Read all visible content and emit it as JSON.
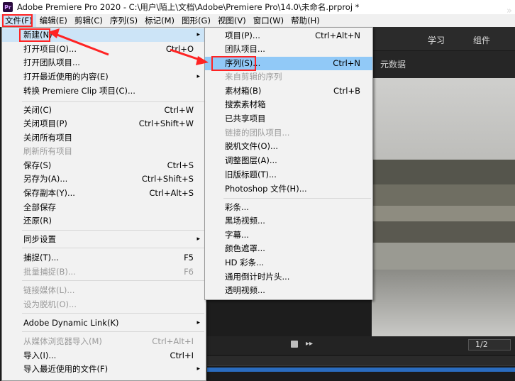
{
  "window": {
    "title": "Adobe Premiere Pro 2020 - C:\\用户\\陌上\\文档\\Adobe\\Premiere Pro\\14.0\\未命名.prproj *",
    "logo_text": "Pr"
  },
  "menubar": [
    "文件(F)",
    "编辑(E)",
    "剪辑(C)",
    "序列(S)",
    "标记(M)",
    "图形(G)",
    "视图(V)",
    "窗口(W)",
    "帮助(H)"
  ],
  "workspace": {
    "tabs": [
      "学习",
      "组件"
    ],
    "more": "»"
  },
  "panel": {
    "tab_label": "元数据"
  },
  "transport": {
    "zoom": "1/2"
  },
  "file_menu": {
    "items": [
      {
        "label": "新建(N)",
        "shortcut": "",
        "submenu": true,
        "state": "highlight"
      },
      {
        "label": "打开项目(O)...",
        "shortcut": "Ctrl+O",
        "state": "normal"
      },
      {
        "label": "打开团队项目...",
        "shortcut": "",
        "state": "normal"
      },
      {
        "label": "打开最近使用的内容(E)",
        "shortcut": "",
        "submenu": true,
        "state": "normal"
      },
      {
        "label": "转换 Premiere Clip 项目(C)...",
        "shortcut": "",
        "state": "normal"
      },
      {
        "label": "关闭(C)",
        "shortcut": "Ctrl+W",
        "state": "normal"
      },
      {
        "label": "关闭项目(P)",
        "shortcut": "Ctrl+Shift+W",
        "state": "normal"
      },
      {
        "label": "关闭所有项目",
        "shortcut": "",
        "state": "normal"
      },
      {
        "label": "刷新所有项目",
        "shortcut": "",
        "state": "disabled"
      },
      {
        "label": "保存(S)",
        "shortcut": "Ctrl+S",
        "state": "normal"
      },
      {
        "label": "另存为(A)...",
        "shortcut": "Ctrl+Shift+S",
        "state": "normal"
      },
      {
        "label": "保存副本(Y)...",
        "shortcut": "Ctrl+Alt+S",
        "state": "normal"
      },
      {
        "label": "全部保存",
        "shortcut": "",
        "state": "normal"
      },
      {
        "label": "还原(R)",
        "shortcut": "",
        "state": "normal"
      },
      {
        "label": "同步设置",
        "shortcut": "",
        "submenu": true,
        "state": "normal"
      },
      {
        "label": "捕捉(T)...",
        "shortcut": "F5",
        "state": "normal"
      },
      {
        "label": "批量捕捉(B)...",
        "shortcut": "F6",
        "state": "disabled"
      },
      {
        "label": "链接媒体(L)...",
        "shortcut": "",
        "state": "disabled"
      },
      {
        "label": "设为脱机(O)...",
        "shortcut": "",
        "state": "disabled"
      },
      {
        "label": "Adobe Dynamic Link(K)",
        "shortcut": "",
        "submenu": true,
        "state": "normal"
      },
      {
        "label": "从媒体浏览器导入(M)",
        "shortcut": "Ctrl+Alt+I",
        "state": "disabled"
      },
      {
        "label": "导入(I)...",
        "shortcut": "Ctrl+I",
        "state": "normal"
      },
      {
        "label": "导入最近使用的文件(F)",
        "shortcut": "",
        "submenu": true,
        "state": "normal"
      }
    ]
  },
  "new_submenu": {
    "items": [
      {
        "label": "项目(P)...",
        "shortcut": "Ctrl+Alt+N",
        "state": "normal"
      },
      {
        "label": "团队项目...",
        "shortcut": "",
        "state": "normal"
      },
      {
        "label": "序列(S)...",
        "shortcut": "Ctrl+N",
        "state": "highlight"
      },
      {
        "label": "来自剪辑的序列",
        "shortcut": "",
        "state": "disabled"
      },
      {
        "label": "素材箱(B)",
        "shortcut": "Ctrl+B",
        "state": "normal"
      },
      {
        "label": "搜索素材箱",
        "shortcut": "",
        "state": "normal"
      },
      {
        "label": "已共享项目",
        "shortcut": "",
        "state": "normal"
      },
      {
        "label": "链接的团队项目...",
        "shortcut": "",
        "state": "disabled"
      },
      {
        "label": "脱机文件(O)...",
        "shortcut": "",
        "state": "normal"
      },
      {
        "label": "调整图层(A)...",
        "shortcut": "",
        "state": "normal"
      },
      {
        "label": "旧版标题(T)...",
        "shortcut": "",
        "state": "normal"
      },
      {
        "label": "Photoshop 文件(H)...",
        "shortcut": "",
        "state": "normal"
      },
      {
        "label": "彩条...",
        "shortcut": "",
        "state": "normal"
      },
      {
        "label": "黑场视频...",
        "shortcut": "",
        "state": "normal"
      },
      {
        "label": "字幕...",
        "shortcut": "",
        "state": "normal"
      },
      {
        "label": "颜色遮罩...",
        "shortcut": "",
        "state": "normal"
      },
      {
        "label": "HD 彩条...",
        "shortcut": "",
        "state": "normal"
      },
      {
        "label": "通用倒计时片头...",
        "shortcut": "",
        "state": "normal"
      },
      {
        "label": "透明视频...",
        "shortcut": "",
        "state": "normal"
      }
    ]
  },
  "colors": {
    "menu_highlight": "#cce4f7",
    "menu_highlight_strong": "#91c9f7",
    "annotation_red": "#ff2323",
    "timeline_blue": "#2a6cbf"
  }
}
